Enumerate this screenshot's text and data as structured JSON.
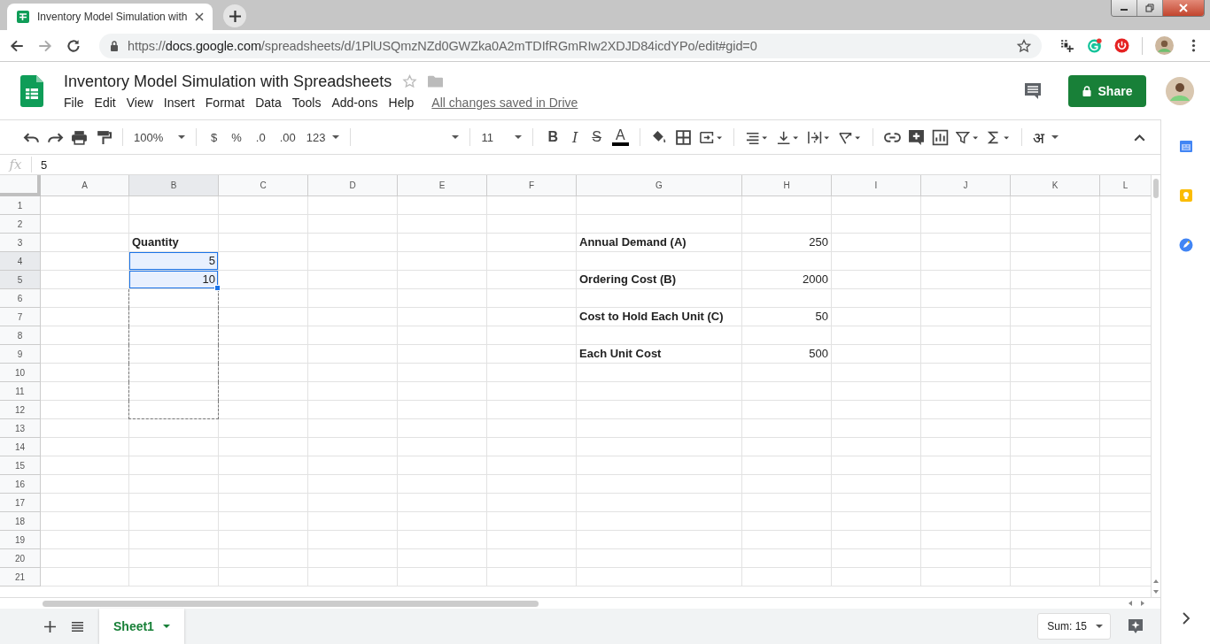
{
  "browser": {
    "tab_title": "Inventory Model Simulation with",
    "url_scheme": "https://",
    "url_host": "docs.google.com",
    "url_path": "/spreadsheets/d/1PlUSQmzNZd0GWZka0A2mTDIfRGmRIw2XDJD84icdYPo/edit#gid=0"
  },
  "document": {
    "title": "Inventory Model Simulation with Spreadsheets",
    "save_status": "All changes saved in Drive",
    "share_label": "Share"
  },
  "menu": [
    "File",
    "Edit",
    "View",
    "Insert",
    "Format",
    "Data",
    "Tools",
    "Add-ons",
    "Help"
  ],
  "toolbar": {
    "zoom": "100%",
    "currency": "$",
    "percent": "%",
    "decrease_decimals": ".0",
    "increase_decimals": ".00",
    "number_format": "123",
    "font_size": "11",
    "bold": "B",
    "italic": "I",
    "strikethrough": "S",
    "text_color": "A",
    "input_tools": "अ"
  },
  "formula_bar": {
    "label": "fx",
    "value": "5"
  },
  "columns": [
    {
      "label": "A",
      "selected": false
    },
    {
      "label": "B",
      "selected": true
    },
    {
      "label": "C",
      "selected": false
    },
    {
      "label": "D",
      "selected": false
    },
    {
      "label": "E",
      "selected": false
    },
    {
      "label": "F",
      "selected": false
    },
    {
      "label": "G",
      "selected": false
    },
    {
      "label": "H",
      "selected": false
    },
    {
      "label": "I",
      "selected": false
    },
    {
      "label": "J",
      "selected": false
    },
    {
      "label": "K",
      "selected": false
    },
    {
      "label": "L",
      "selected": false
    }
  ],
  "rows": [
    {
      "label": "1",
      "selected": false,
      "cells": [
        {},
        {},
        {},
        {},
        {},
        {},
        {},
        {},
        {},
        {},
        {},
        {}
      ]
    },
    {
      "label": "2",
      "selected": false,
      "cells": [
        {},
        {},
        {},
        {},
        {},
        {},
        {},
        {},
        {},
        {},
        {},
        {}
      ]
    },
    {
      "label": "3",
      "selected": false,
      "cells": [
        {},
        {
          "text": "Quantity",
          "kind": "text",
          "bold": true
        },
        {},
        {},
        {},
        {},
        {
          "text": "Annual Demand (A)",
          "kind": "text",
          "bold": true
        },
        {
          "text": "250",
          "kind": "number",
          "bold": false
        },
        {},
        {},
        {},
        {}
      ]
    },
    {
      "label": "4",
      "selected": true,
      "cells": [
        {},
        {
          "text": "5",
          "kind": "number",
          "bold": false,
          "selected": true
        },
        {},
        {},
        {},
        {},
        {},
        {},
        {},
        {},
        {},
        {}
      ]
    },
    {
      "label": "5",
      "selected": true,
      "cells": [
        {},
        {
          "text": "10",
          "kind": "number",
          "bold": false,
          "selected": true
        },
        {},
        {},
        {},
        {},
        {
          "text": "Ordering Cost (B)",
          "kind": "text",
          "bold": true
        },
        {
          "text": "2000",
          "kind": "number",
          "bold": false
        },
        {},
        {},
        {},
        {}
      ]
    },
    {
      "label": "6",
      "selected": false,
      "cells": [
        {},
        {
          "outlined": true
        },
        {},
        {},
        {},
        {},
        {},
        {},
        {},
        {},
        {},
        {}
      ]
    },
    {
      "label": "7",
      "selected": false,
      "cells": [
        {},
        {
          "outlined": true
        },
        {},
        {},
        {},
        {},
        {
          "text": "Cost to Hold Each Unit (C)",
          "kind": "text",
          "bold": true
        },
        {
          "text": "50",
          "kind": "number",
          "bold": false
        },
        {},
        {},
        {},
        {}
      ]
    },
    {
      "label": "8",
      "selected": false,
      "cells": [
        {},
        {
          "outlined": true
        },
        {},
        {},
        {},
        {},
        {},
        {},
        {},
        {},
        {},
        {}
      ]
    },
    {
      "label": "9",
      "selected": false,
      "cells": [
        {},
        {
          "outlined": true
        },
        {},
        {},
        {},
        {},
        {
          "text": "Each Unit Cost",
          "kind": "text",
          "bold": true
        },
        {
          "text": "500",
          "kind": "number",
          "bold": false
        },
        {},
        {},
        {},
        {}
      ]
    },
    {
      "label": "10",
      "selected": false,
      "cells": [
        {},
        {
          "outlined": true
        },
        {},
        {},
        {},
        {},
        {},
        {},
        {},
        {},
        {},
        {}
      ]
    },
    {
      "label": "11",
      "selected": false,
      "cells": [
        {},
        {
          "outlined": true
        },
        {},
        {},
        {},
        {},
        {},
        {},
        {},
        {},
        {},
        {}
      ]
    },
    {
      "label": "12",
      "selected": false,
      "cells": [
        {},
        {
          "outlined": true
        },
        {},
        {},
        {},
        {},
        {},
        {},
        {},
        {},
        {},
        {}
      ]
    },
    {
      "label": "13",
      "selected": false,
      "cells": [
        {},
        {},
        {},
        {},
        {},
        {},
        {},
        {},
        {},
        {},
        {},
        {}
      ]
    },
    {
      "label": "14",
      "selected": false,
      "cells": [
        {},
        {},
        {},
        {},
        {},
        {},
        {},
        {},
        {},
        {},
        {},
        {}
      ]
    },
    {
      "label": "15",
      "selected": false,
      "cells": [
        {},
        {},
        {},
        {},
        {},
        {},
        {},
        {},
        {},
        {},
        {},
        {}
      ]
    },
    {
      "label": "16",
      "selected": false,
      "cells": [
        {},
        {},
        {},
        {},
        {},
        {},
        {},
        {},
        {},
        {},
        {},
        {}
      ]
    },
    {
      "label": "17",
      "selected": false,
      "cells": [
        {},
        {},
        {},
        {},
        {},
        {},
        {},
        {},
        {},
        {},
        {},
        {}
      ]
    },
    {
      "label": "18",
      "selected": false,
      "cells": [
        {},
        {},
        {},
        {},
        {},
        {},
        {},
        {},
        {},
        {},
        {},
        {}
      ]
    },
    {
      "label": "19",
      "selected": false,
      "cells": [
        {},
        {},
        {},
        {},
        {},
        {},
        {},
        {},
        {},
        {},
        {},
        {}
      ]
    },
    {
      "label": "20",
      "selected": false,
      "cells": [
        {},
        {},
        {},
        {},
        {},
        {},
        {},
        {},
        {},
        {},
        {},
        {}
      ]
    },
    {
      "label": "21",
      "selected": false,
      "cells": [
        {},
        {},
        {},
        {},
        {},
        {},
        {},
        {},
        {},
        {},
        {},
        {}
      ]
    }
  ],
  "sheets": [
    {
      "name": "Sheet1",
      "selected": true
    }
  ],
  "status": {
    "sum": "Sum: 15"
  }
}
